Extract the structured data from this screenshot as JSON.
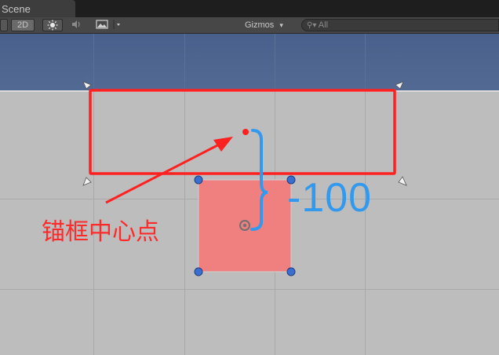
{
  "tab": {
    "title": "Scene"
  },
  "toolbar": {
    "mode_2d": "2D",
    "gizmos_label": "Gizmos",
    "search_placeholder": "All"
  },
  "annotations": {
    "anchor_center_label": "锚框中心点",
    "offset_value": "-100"
  },
  "colors": {
    "anchor_box": "#ff2020",
    "rect_fill": "#f08080",
    "offset_brace": "#3399ee",
    "sky": "#4d6590"
  }
}
